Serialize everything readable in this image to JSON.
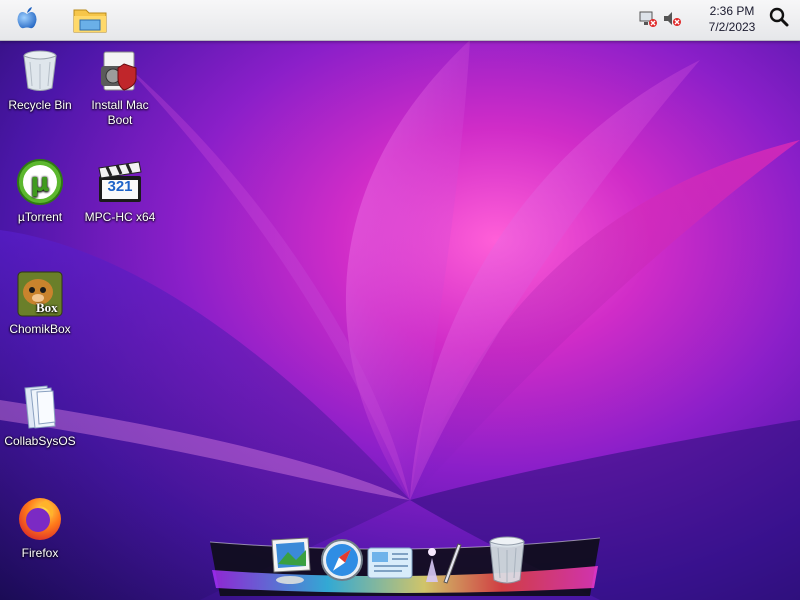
{
  "menubar": {
    "apple_icon": "apple-icon",
    "explorer_icon": "file-explorer-icon",
    "tray": [
      "network-disconnected-icon",
      "volume-muted-icon"
    ],
    "clock_time": "2:36 PM",
    "clock_date": "7/2/2023",
    "search_icon": "search-icon"
  },
  "desktop": {
    "icons": [
      {
        "label": "Recycle Bin",
        "icon": "recycle-bin-icon"
      },
      {
        "label": "Install Mac Boot",
        "icon": "installer-shield-icon"
      },
      {
        "label": "µTorrent",
        "icon": "utorrent-icon"
      },
      {
        "label": "MPC-HC x64",
        "icon": "mpc-hc-clapper-icon",
        "badge": "321"
      },
      {
        "label": "ChomikBox",
        "icon": "chomikbox-icon",
        "badge": "Box"
      },
      {
        "label": "CollabSysOS",
        "icon": "folder-document-icon"
      },
      {
        "label": "Firefox",
        "icon": "firefox-icon"
      }
    ]
  },
  "dock": {
    "items": [
      "finder-photo-icon",
      "safari-compass-icon",
      "system-preferences-icon",
      "pencil-icon",
      "trash-icon"
    ]
  },
  "colors": {
    "wallpaper_center": "#ff5fd8",
    "wallpaper_mid": "#8b1fc9",
    "wallpaper_edge": "#1a0b55",
    "menubar": "#eeeef1"
  }
}
